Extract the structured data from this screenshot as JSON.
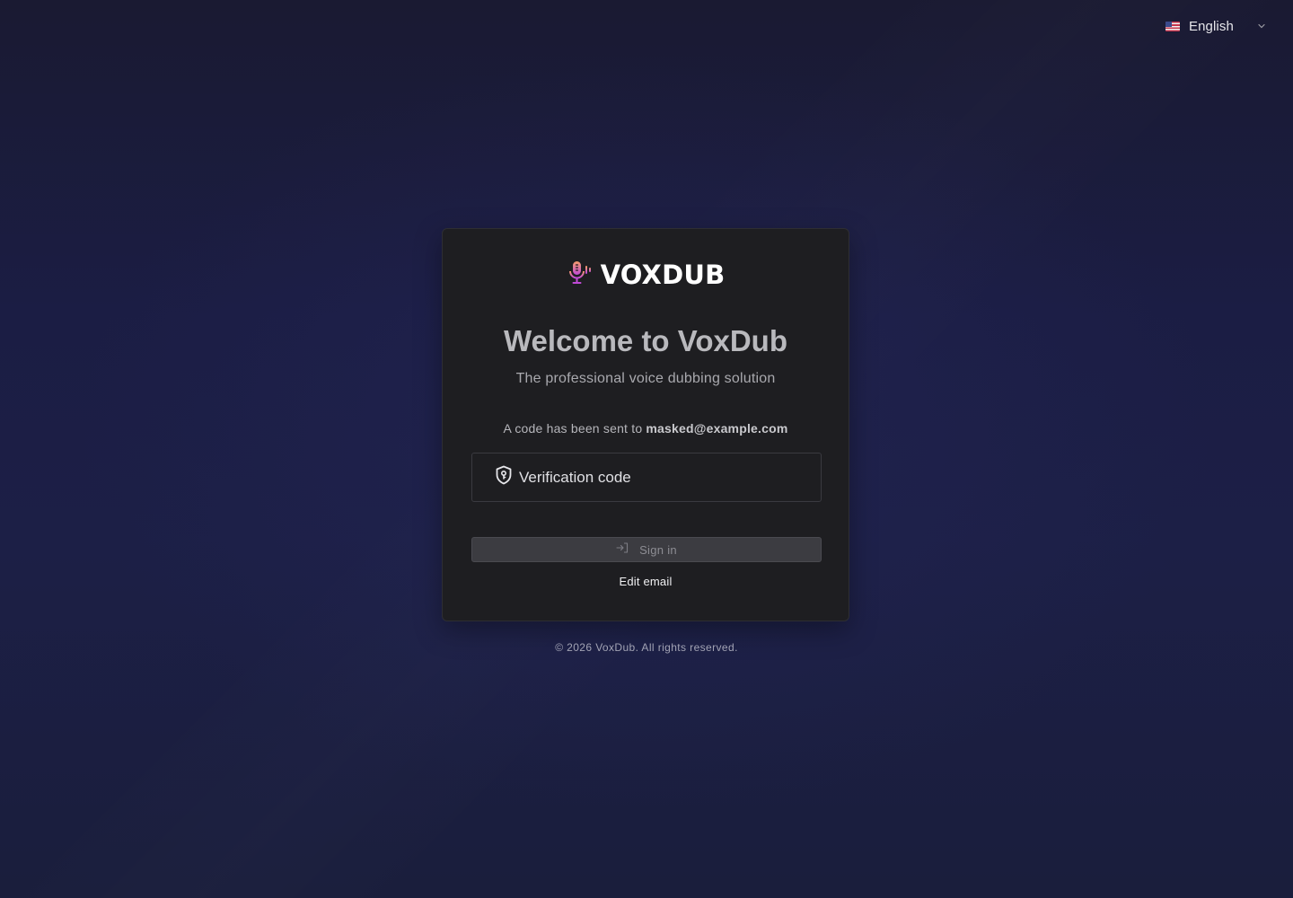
{
  "language": {
    "flag_icon": "us-flag-icon",
    "label": "English"
  },
  "brand": {
    "logo_icon": "microphone-icon",
    "name": "VOXDUB",
    "colors": {
      "logo_gradient_top": "#f59c6b",
      "logo_gradient_bottom": "#c04ad6"
    }
  },
  "auth": {
    "title": "Welcome to VoxDub",
    "subtitle": "The professional voice dubbing solution",
    "sent_prefix": "A code has been sent to",
    "email": "masked@example.com",
    "code_icon": "shield-key-icon",
    "code_placeholder": "Verification code",
    "code_value": "",
    "signin_icon": "sign-in-icon",
    "signin_label": "Sign in",
    "edit_email_label": "Edit email"
  },
  "footer": {
    "copyright": "© 2026 VoxDub. All rights reserved."
  }
}
